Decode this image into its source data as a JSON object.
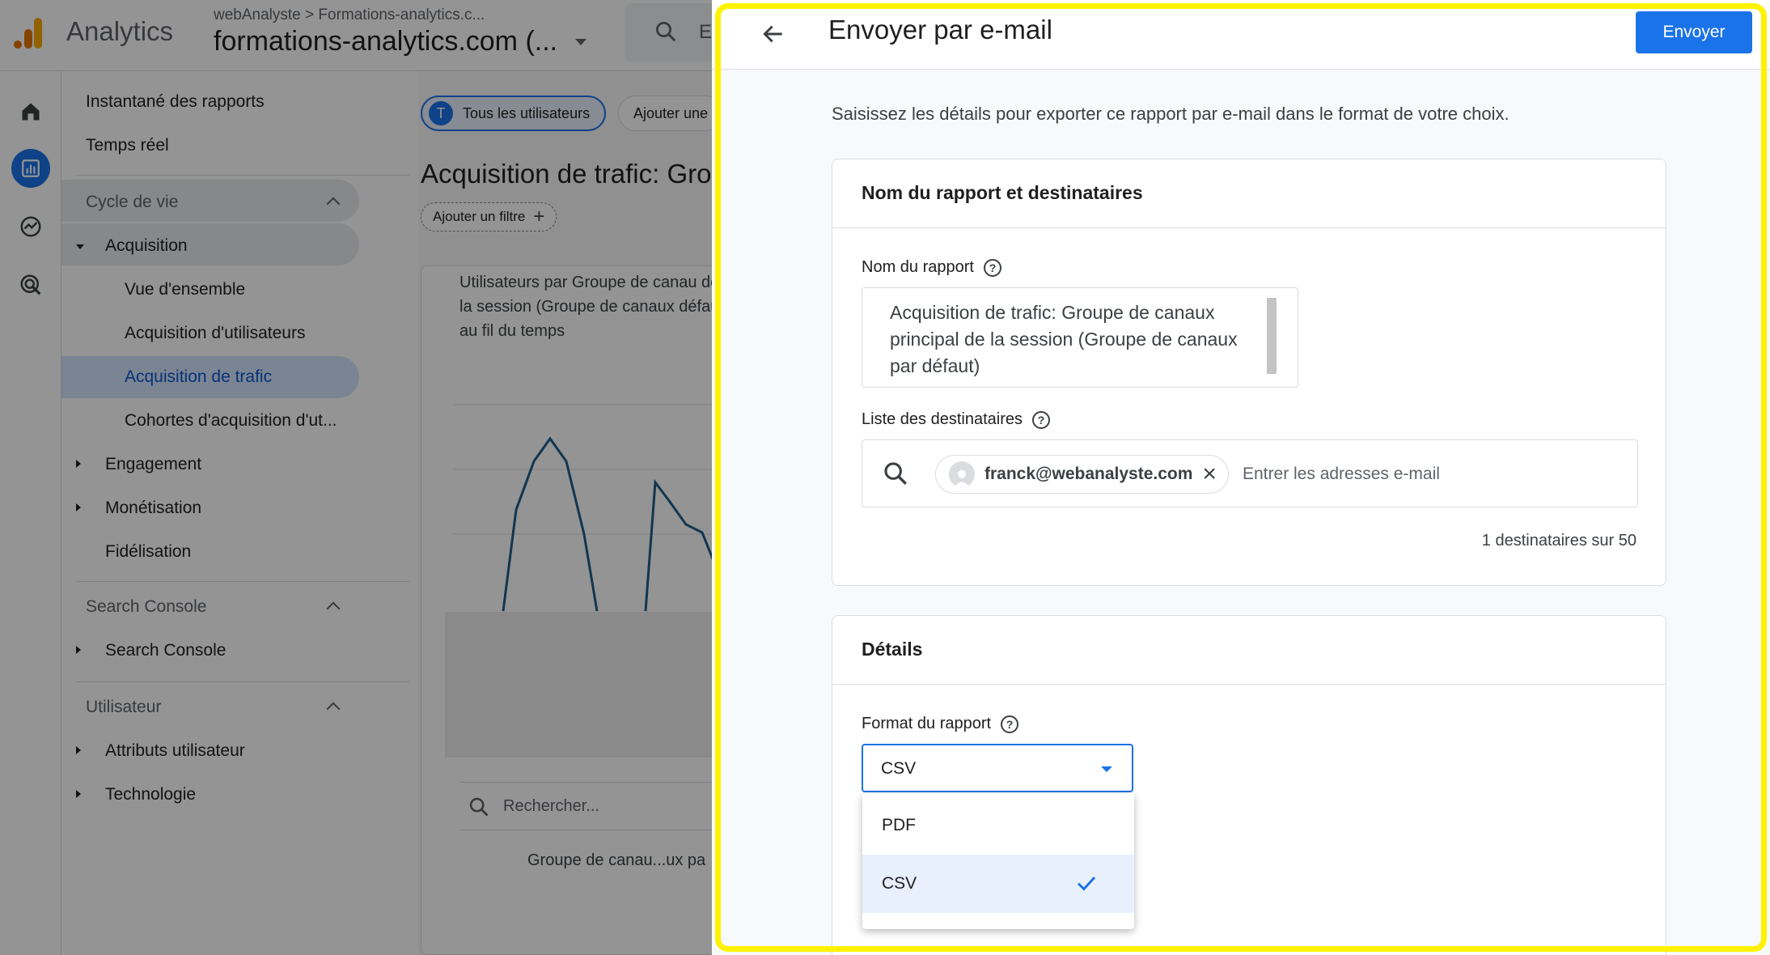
{
  "app": {
    "name": "Analytics",
    "breadcrumb_account": "webAnalyste",
    "breadcrumb_property": "Formations-analytics.c...",
    "property_name": "formations-analytics.com (...",
    "search_placeholder": "E"
  },
  "nav": {
    "snapshot": "Instantané des rapports",
    "realtime": "Temps réel",
    "lifecycle": {
      "label": "Cycle de vie",
      "acquisition": "Acquisition",
      "acquisition_items": [
        "Vue d'ensemble",
        "Acquisition d'utilisateurs",
        "Acquisition de trafic",
        "Cohortes d'acquisition d'ut..."
      ],
      "engagement": "Engagement",
      "monetization": "Monétisation",
      "retention": "Fidélisation"
    },
    "search_console": {
      "label": "Search Console",
      "item": "Search Console"
    },
    "user": {
      "label": "Utilisateur",
      "attributes": "Attributs utilisateur",
      "tech": "Technologie"
    }
  },
  "report": {
    "segment_initial": "T",
    "segment_chip": "Tous les utilisateurs",
    "add_comparison": "Ajouter une",
    "title": "Acquisition de trafic: Gro",
    "add_filter": "Ajouter un filtre",
    "chart_title": "Utilisateurs par Groupe de canau de la session (Groupe de canaux défaut) au fil du temps",
    "table_search_placeholder": "Rechercher...",
    "table_header": "Groupe de canau...ux pa"
  },
  "drawer": {
    "title": "Envoyer par e-mail",
    "send_button": "Envoyer",
    "intro": "Saisissez les détails pour exporter ce rapport par e-mail dans le format de votre choix.",
    "section1": {
      "title": "Nom du rapport et destinataires",
      "name_label": "Nom du rapport",
      "name_value": "Acquisition de trafic: Groupe de canaux principal de la session (Groupe de canaux par défaut)",
      "recipients_label": "Liste des destinataires",
      "recipient_chip": "franck@webanalyste.com",
      "recipients_placeholder": "Entrer les adresses e-mail",
      "recipients_count": "1 destinataires sur 50"
    },
    "section2": {
      "title": "Détails",
      "format_label": "Format du rapport",
      "format_value": "CSV",
      "format_options": [
        "PDF",
        "CSV"
      ]
    }
  },
  "colors": {
    "accent": "#1a73e8",
    "highlight": "#fff200",
    "chart_line": "#1f5e8c"
  },
  "icons": {
    "help": "?",
    "remove": "×",
    "add": "+"
  }
}
